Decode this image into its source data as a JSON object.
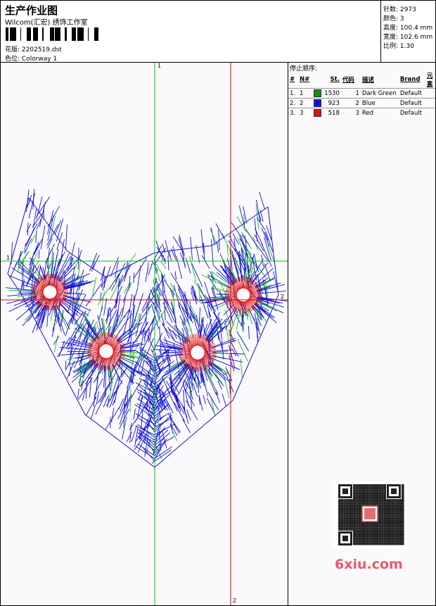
{
  "header": {
    "title": "生产作业图",
    "company": "Wilcom(汇宏) 绣饰工作室",
    "design_label": "花版:",
    "design_value": "2202519.dst",
    "colorway_label": "色位:",
    "colorway_value": "Colorway 1"
  },
  "stats": [
    {
      "label": "针数:",
      "value": "2973"
    },
    {
      "label": "颜色:",
      "value": "3"
    },
    {
      "label": "高度:",
      "value": "100.4 mm"
    },
    {
      "label": "宽度:",
      "value": "102.6 mm"
    },
    {
      "label": "比例:",
      "value": "1.30"
    }
  ],
  "stop_sequence": {
    "heading": "停止顺序:",
    "columns": [
      "#",
      "N#",
      "St.",
      "代码",
      "描述",
      "Brand",
      "元素"
    ],
    "rows": [
      {
        "no": "1.",
        "n": "1",
        "color": "#1a8a1a",
        "st": "1530",
        "code": "1",
        "desc": "Dark Green",
        "brand": "Default",
        "element": ""
      },
      {
        "no": "2.",
        "n": "2",
        "color": "#1010e0",
        "st": "923",
        "code": "2",
        "desc": "Blue",
        "brand": "Default",
        "element": ""
      },
      {
        "no": "3.",
        "n": "3",
        "color": "#e01010",
        "st": "518",
        "code": "3",
        "desc": "Red",
        "brand": "Default",
        "element": ""
      }
    ]
  },
  "guides": {
    "h_marker": "1",
    "v_marker_top": "1",
    "v_marker_bottom": "2",
    "h_right_marker": "2"
  },
  "colors": {
    "green": "#19c019",
    "blue": "#1010d8",
    "red": "#e01010",
    "guide_green": "#00c800",
    "guide_red": "#e00000"
  },
  "watermark": {
    "text": "6xiu.com"
  }
}
